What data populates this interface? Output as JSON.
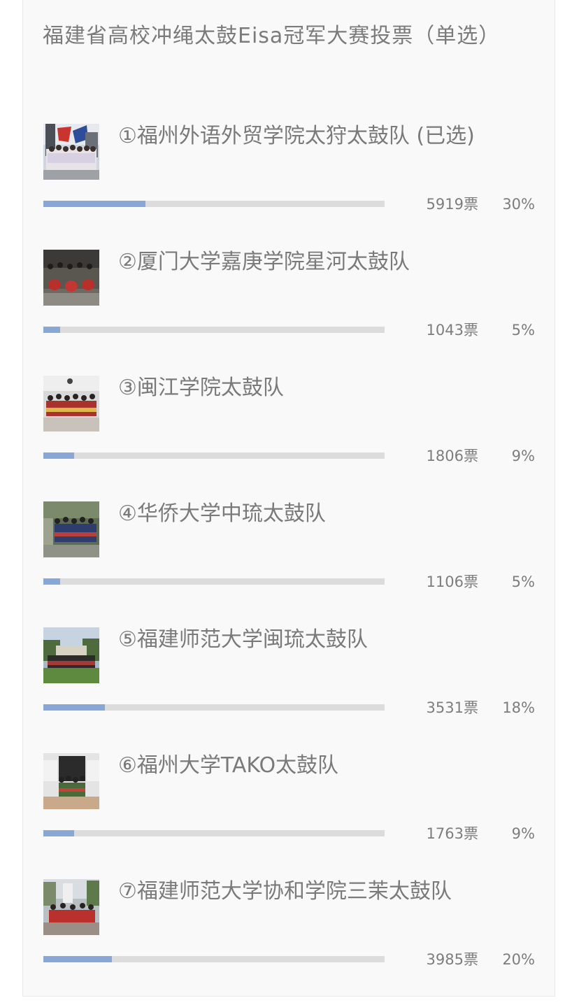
{
  "poll": {
    "title": "福建省高校冲绳太鼓Eisa冠军大赛投票（单选）",
    "accent_color": "#87a8d6",
    "track_color": "#dcdcdc",
    "options": [
      {
        "label": "①福州外语外贸学院太狩太鼓队 (已选)",
        "votes": "5919票",
        "percent": "30%",
        "fraction": 0.3
      },
      {
        "label": "②厦门大学嘉庚学院星河太鼓队",
        "votes": "1043票",
        "percent": "5%",
        "fraction": 0.05
      },
      {
        "label": "③闽江学院太鼓队",
        "votes": "1806票",
        "percent": "9%",
        "fraction": 0.09
      },
      {
        "label": "④华侨大学中琉太鼓队",
        "votes": "1106票",
        "percent": "5%",
        "fraction": 0.05
      },
      {
        "label": "⑤福建师范大学闽琉太鼓队",
        "votes": "3531票",
        "percent": "18%",
        "fraction": 0.18
      },
      {
        "label": "⑥福州大学TAKO太鼓队",
        "votes": "1763票",
        "percent": "9%",
        "fraction": 0.09
      },
      {
        "label": "⑦福建师范大学协和学院三茉太鼓队",
        "votes": "3985票",
        "percent": "20%",
        "fraction": 0.2
      }
    ]
  }
}
